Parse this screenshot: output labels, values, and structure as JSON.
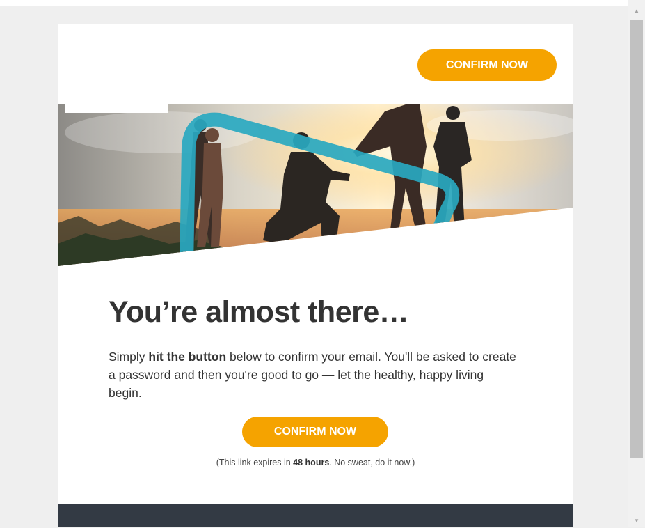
{
  "colors": {
    "accent": "#f5a300",
    "footer": "#333a44",
    "teal": "#29a8c0",
    "text": "#333333"
  },
  "header": {
    "confirm_label": "CONFIRM NOW"
  },
  "hero": {
    "description_icon": "people-at-sunset-hero-image"
  },
  "main": {
    "headline": "You’re almost there…",
    "body_pre": "Simply ",
    "body_bold": "hit the button",
    "body_post": " below to confirm your email. You'll be asked to create a password and then you're good to go — let the healthy, happy living begin.",
    "confirm_label": "CONFIRM NOW",
    "expiry_pre": "(This link expires in ",
    "expiry_bold": "48 hours",
    "expiry_post": ". No sweat, do it now.)"
  },
  "scrollbar": {
    "up_icon": "arrow-up-icon",
    "down_icon": "arrow-down-icon"
  }
}
